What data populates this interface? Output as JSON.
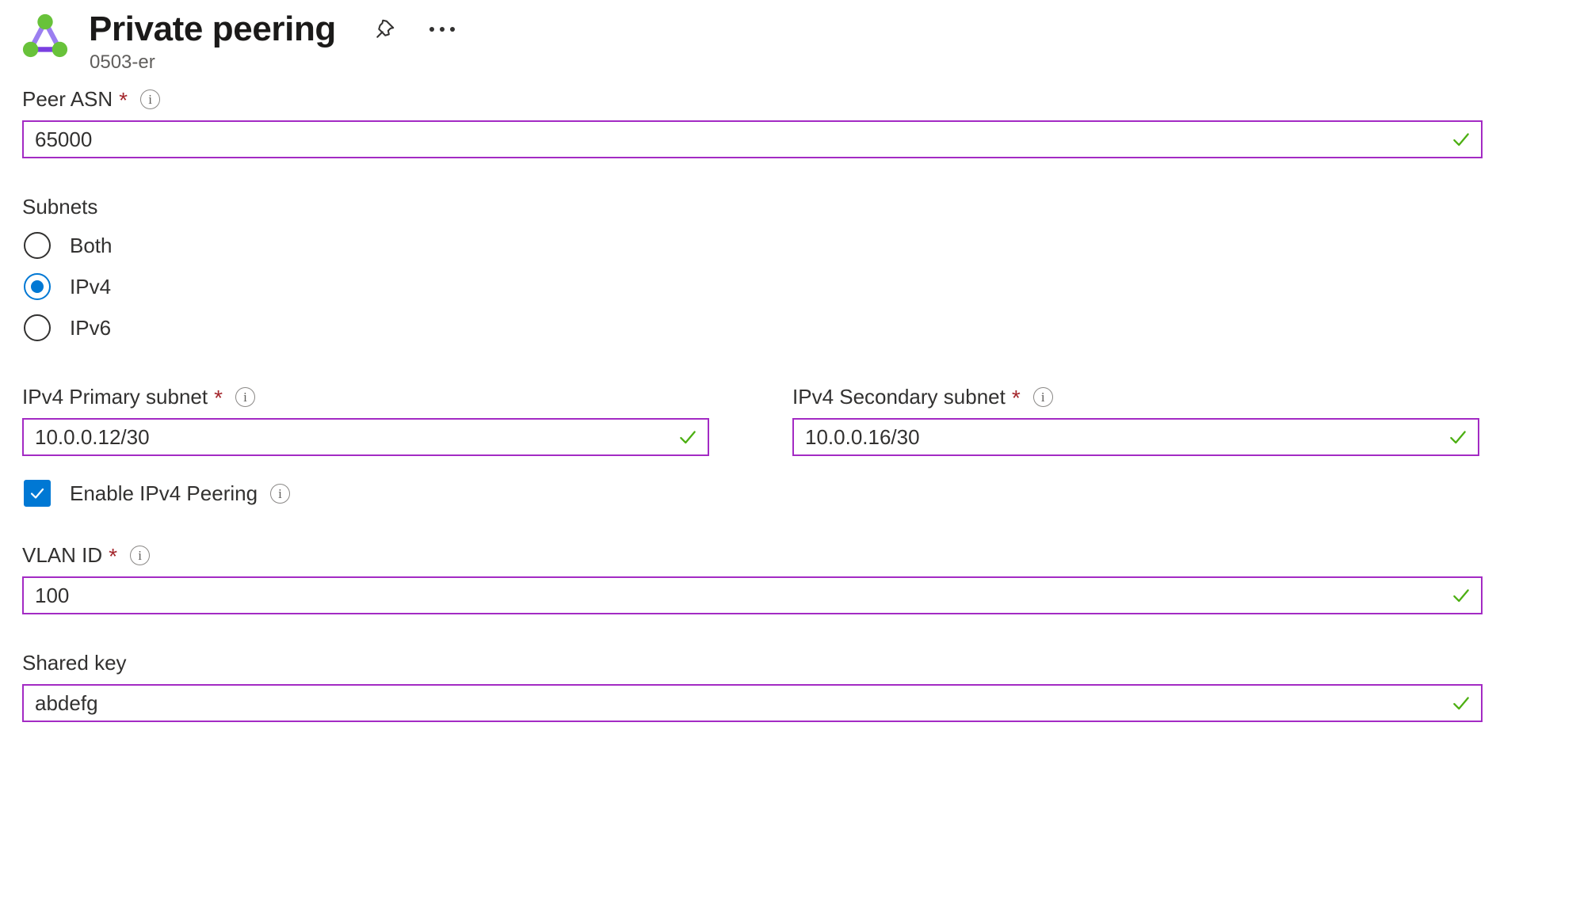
{
  "header": {
    "title": "Private peering",
    "subtitle": "0503-er",
    "resource_icon": "expressroute-peering-icon",
    "pin_icon": "pin-icon",
    "more_icon": "ellipsis-icon"
  },
  "form": {
    "peer_asn": {
      "label": "Peer ASN",
      "required_marker": "*",
      "info_icon": "info-icon",
      "value": "65000",
      "valid": true
    },
    "subnets": {
      "label": "Subnets",
      "selected": "IPv4",
      "options": [
        {
          "label": "Both",
          "checked": false
        },
        {
          "label": "IPv4",
          "checked": true
        },
        {
          "label": "IPv6",
          "checked": false
        }
      ]
    },
    "ipv4_primary_subnet": {
      "label": "IPv4 Primary subnet",
      "required_marker": "*",
      "value": "10.0.0.12/30",
      "valid": true
    },
    "ipv4_secondary_subnet": {
      "label": "IPv4 Secondary subnet",
      "required_marker": "*",
      "value": "10.0.0.16/30",
      "valid": true
    },
    "enable_ipv4_peering": {
      "label": "Enable IPv4 Peering",
      "checked": true
    },
    "vlan_id": {
      "label": "VLAN ID",
      "required_marker": "*",
      "value": "100",
      "valid": true
    },
    "shared_key": {
      "label": "Shared key",
      "value": "abdefg",
      "valid": true
    }
  },
  "colors": {
    "input_border": "#a32bc4",
    "valid_check": "#4caf12",
    "accent_blue": "#0078d4",
    "required_red": "#a4262c",
    "icon_purple": "#8661f0",
    "icon_green": "#68c23a"
  }
}
